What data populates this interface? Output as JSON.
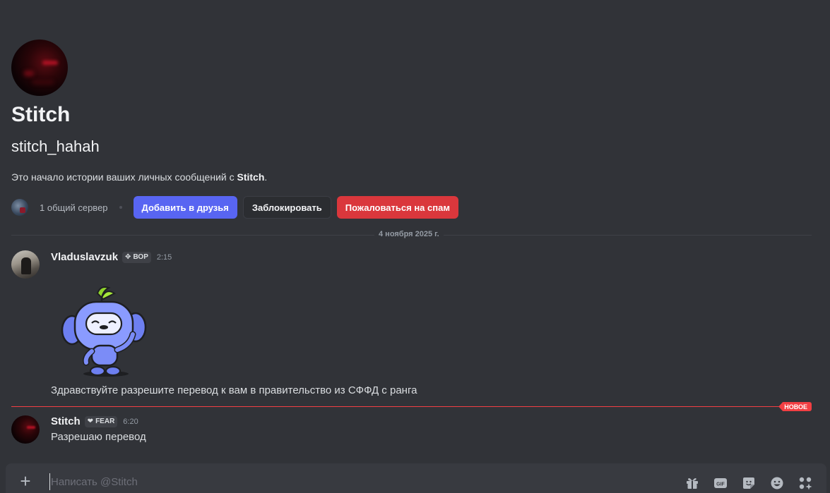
{
  "profile": {
    "display_name": "Stitch",
    "username": "stitch_hahah",
    "intro_prefix": "Это начало истории ваших личных сообщений с ",
    "intro_name": "Stitch",
    "intro_suffix": ".",
    "mutual_servers": "1 общий сервер"
  },
  "actions": {
    "add_friend": "Добавить в друзья",
    "block": "Заблокировать",
    "report_spam": "Пожаловаться на спам"
  },
  "date_divider": "4 ноября 2025 г.",
  "messages": [
    {
      "author": "Vladuslavzuk",
      "tag": "ВОР",
      "time": "2:15",
      "text": "Здравствуйте разрешите перевод к вам в правительство из СФФД с  ранга"
    },
    {
      "author": "Stitch",
      "tag": "FEAR",
      "time": "6:20",
      "text": "Разрешаю перевод"
    }
  ],
  "new_badge": "НОВОЕ",
  "composer": {
    "placeholder": "Написать @Stitch"
  },
  "colors": {
    "background": "#313338",
    "primary": "#5865f2",
    "danger": "#da373c",
    "new_divider": "#f23f43"
  },
  "icons": [
    "plus-icon",
    "gift-icon",
    "gif-icon",
    "sticker-icon",
    "emoji-icon",
    "apps-icon"
  ]
}
